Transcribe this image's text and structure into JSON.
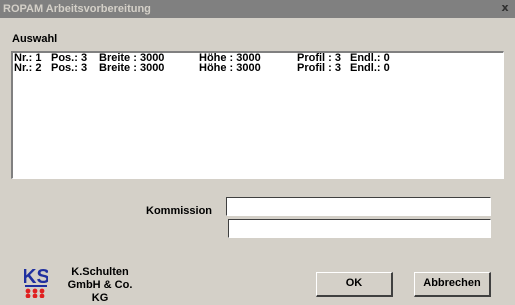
{
  "window": {
    "title": "ROPAM Arbeitsvorbereitung",
    "close_glyph": "x"
  },
  "group": {
    "label": "Auswahl"
  },
  "list": {
    "rows": [
      [
        "Nr.: 1",
        "Pos.: 3",
        "Breite : 3000",
        "Höhe : 3000",
        "Profil : 3",
        "Endl.: 0"
      ],
      [
        "Nr.: 2",
        "Pos.: 3",
        "Breite : 3000",
        "Höhe : 3000",
        "Profil : 3",
        "Endl.: 0"
      ]
    ]
  },
  "kommission": {
    "label": "Kommission",
    "value1": "",
    "value2": ""
  },
  "company": {
    "line1": "K.Schulten",
    "line2": "GmbH & Co. KG",
    "logo_text": "KS"
  },
  "buttons": {
    "ok": "OK",
    "cancel": "Abbrechen"
  },
  "colors": {
    "logo_blue": "#1f2f9f",
    "logo_red": "#e02020",
    "titlebar": "#808080"
  }
}
